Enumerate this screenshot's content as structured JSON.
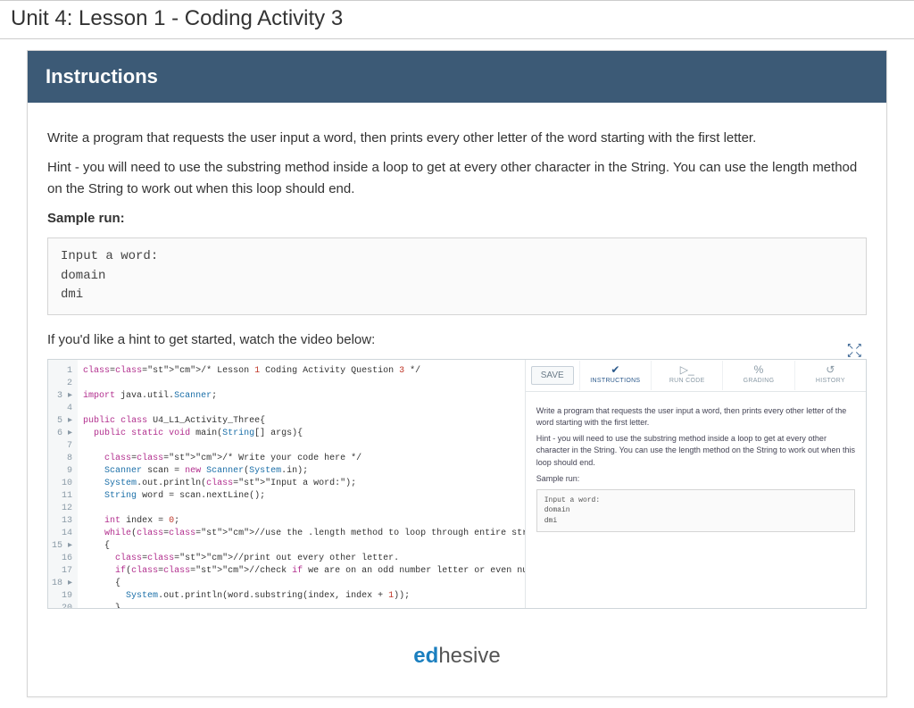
{
  "page": {
    "title": "Unit 4: Lesson 1 - Coding Activity 3"
  },
  "instructions": {
    "header": "Instructions",
    "p1": "Write a program that requests the user input a word, then prints every other letter of the word starting with the first letter.",
    "p2": "Hint - you will need to use the substring method inside a loop to get at every other character in the String. You can use the length method on the String to work out when this loop should end.",
    "sample_label": "Sample run:",
    "sample": "Input a word:\ndomain\ndmi",
    "hint_video": "If you'd like a hint to get started, watch the video below:"
  },
  "ide": {
    "save": "SAVE",
    "tabs": {
      "instructions": "INSTRUCTIONS",
      "run": "RUN CODE",
      "grading": "GRADING",
      "history": "HISTORY"
    },
    "code_lines": [
      "/* Lesson 1 Coding Activity Question 3 */",
      "",
      "import java.util.Scanner;",
      "",
      "public class U4_L1_Activity_Three{",
      "  public static void main(String[] args){",
      "",
      "    /* Write your code here */",
      "    Scanner scan = new Scanner(System.in);",
      "    System.out.println(\"Input a word:\");",
      "    String word = scan.nextLine();",
      "",
      "    int index = 0;",
      "    while(//use the .length method to loop through entire string)",
      "    {",
      "      //print out every other letter.",
      "      if(//check if we are on an odd number letter or even number)",
      "      {",
      "        System.out.println(word.substring(index, index + 1));",
      "      }",
      "    }",
      "",
      "  }",
      "}"
    ],
    "mini": {
      "p1": "Write a program that requests the user input a word, then prints every other letter of the word starting with the first letter.",
      "p2": "Hint - you will need to use the substring method inside a loop to get at every other character in the String. You can use the length method on the String to work out when this loop should end.",
      "sample_label": "Sample run:",
      "sample": "Input a word:\ndomain\ndmi"
    }
  },
  "brand": {
    "left": "ed",
    "right": "hesive"
  }
}
